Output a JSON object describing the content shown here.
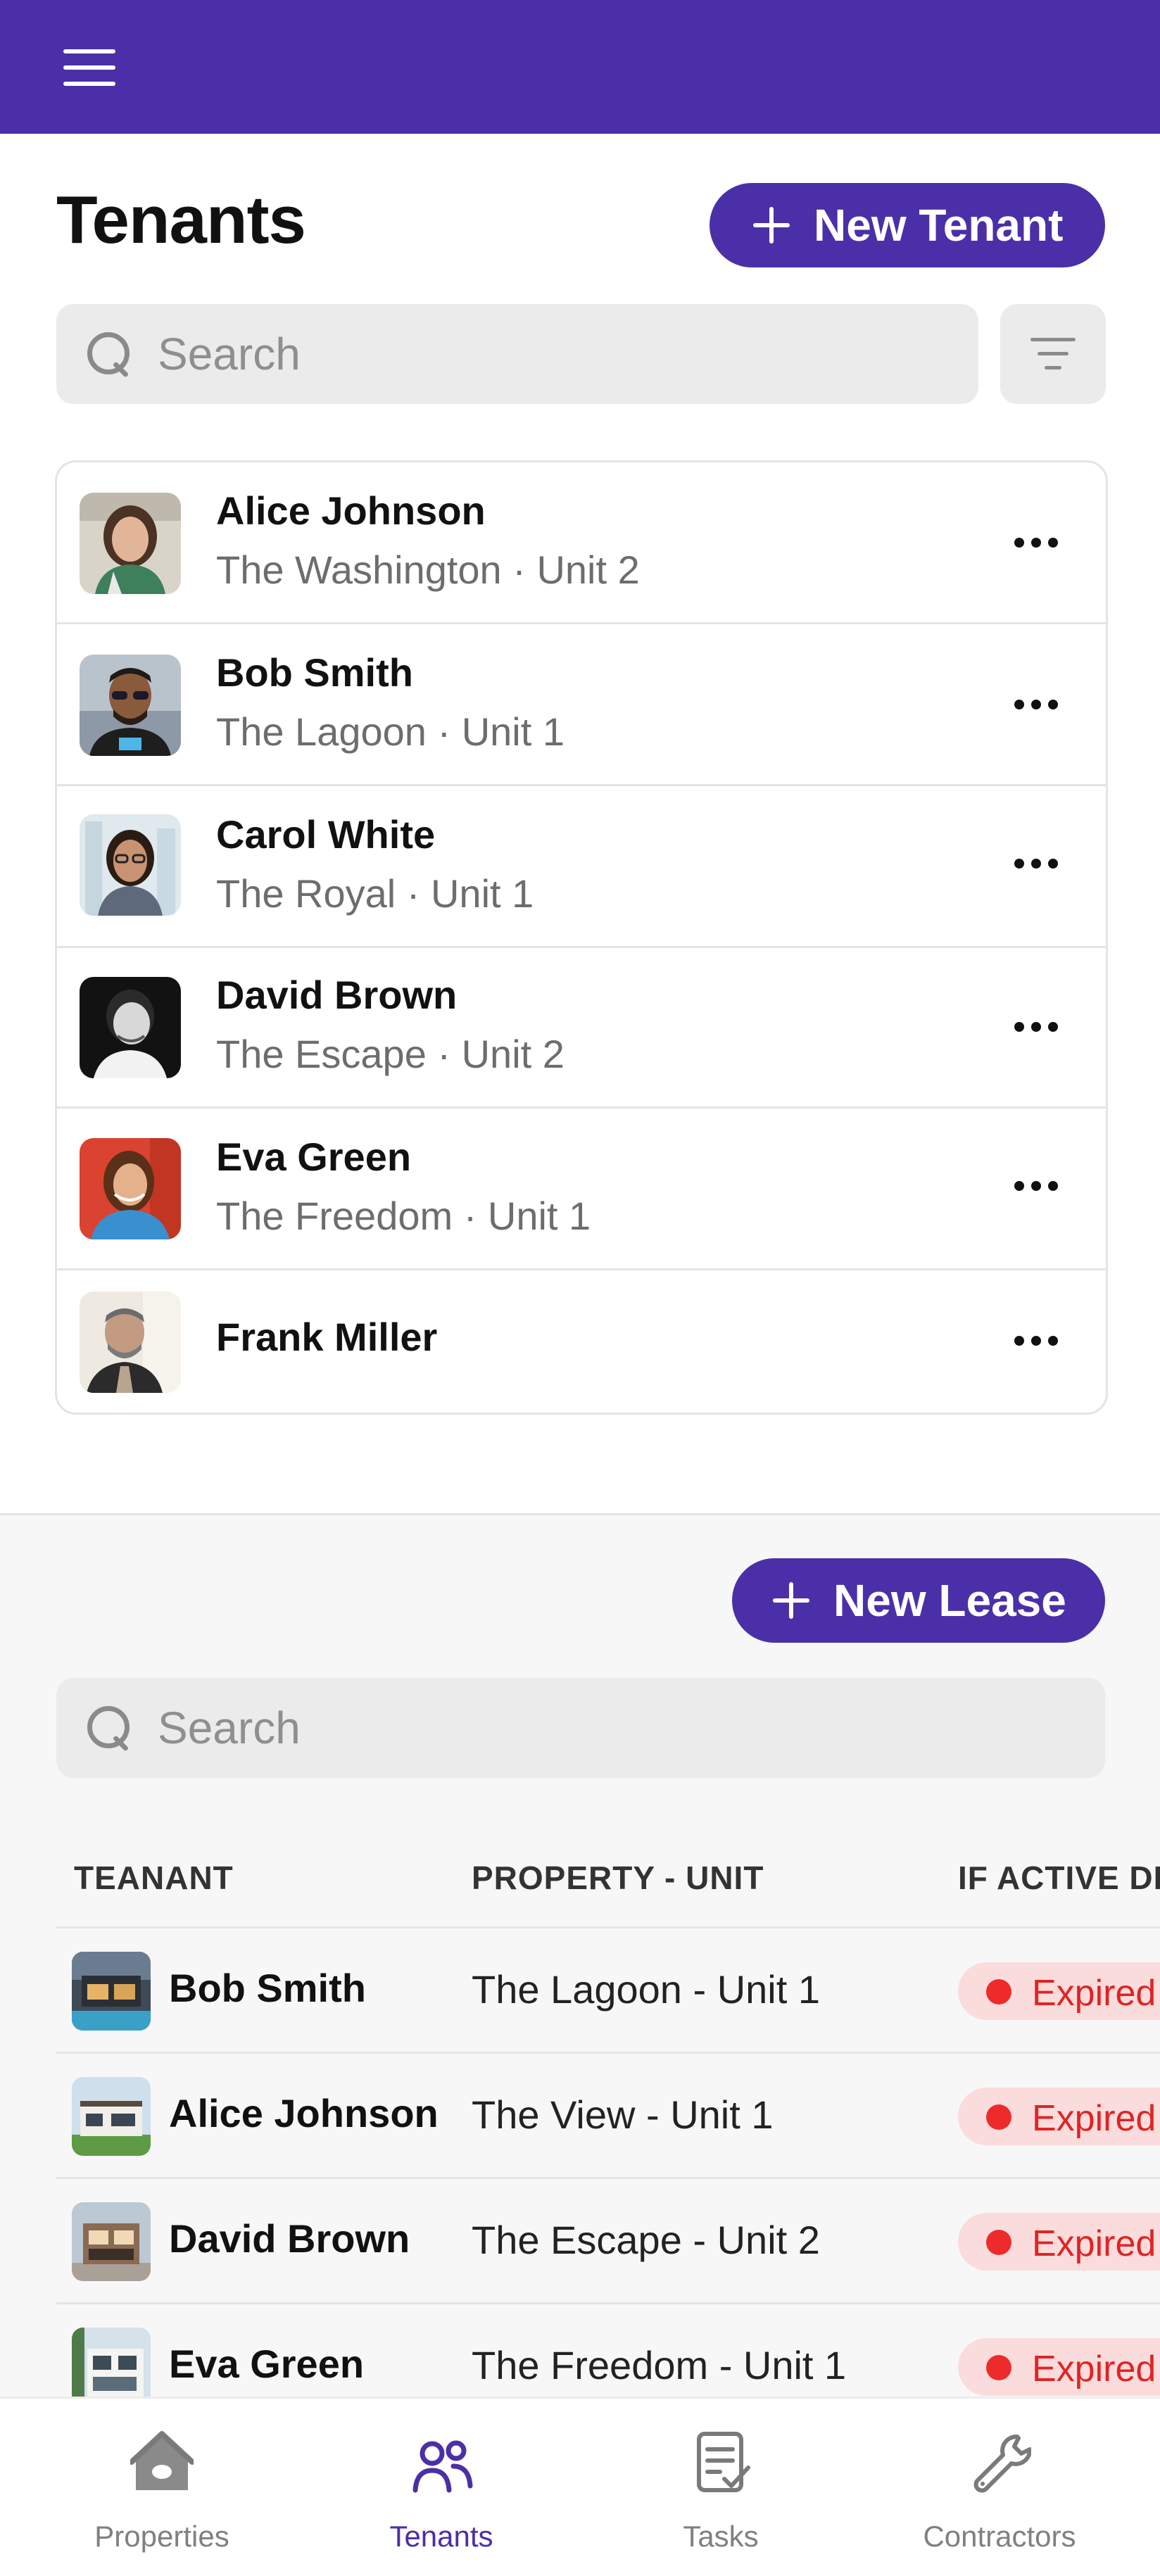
{
  "header": {
    "menu_icon": "hamburger-menu-icon"
  },
  "tenants": {
    "title": "Tenants",
    "new_button": "New Tenant",
    "search_placeholder": "Search",
    "list": [
      {
        "name": "Alice Johnson",
        "subtitle": "The Washington · Unit 2"
      },
      {
        "name": "Bob Smith",
        "subtitle": "The Lagoon · Unit 1"
      },
      {
        "name": "Carol White",
        "subtitle": "The Royal · Unit 1"
      },
      {
        "name": "David Brown",
        "subtitle": "The Escape · Unit 2"
      },
      {
        "name": "Eva Green",
        "subtitle": "The Freedom · Unit 1"
      },
      {
        "name": "Frank Miller",
        "subtitle": ""
      }
    ]
  },
  "leases": {
    "new_button": "New Lease",
    "search_placeholder": "Search",
    "columns": [
      "TEANANT",
      "PROPERTY - UNIT",
      "IF ACTIVE DI"
    ],
    "rows": [
      {
        "tenant": "Bob Smith",
        "property": "The Lagoon - Unit 1",
        "status": "Expired"
      },
      {
        "tenant": "Alice Johnson",
        "property": "The View - Unit 1",
        "status": "Expired"
      },
      {
        "tenant": "David Brown",
        "property": "The Escape - Unit 2",
        "status": "Expired"
      },
      {
        "tenant": "Eva Green",
        "property": "The Freedom - Unit 1",
        "status": "Expired"
      }
    ]
  },
  "nav": {
    "items": [
      {
        "label": "Properties",
        "icon": "home-icon"
      },
      {
        "label": "Tenants",
        "icon": "users-icon",
        "active": true
      },
      {
        "label": "Tasks",
        "icon": "clipboard-check-icon"
      },
      {
        "label": "Contractors",
        "icon": "wrench-icon"
      }
    ]
  },
  "colors": {
    "brand": "#4b2fa8",
    "expired_bg": "#fbdcdc",
    "expired_text": "#e02424"
  }
}
